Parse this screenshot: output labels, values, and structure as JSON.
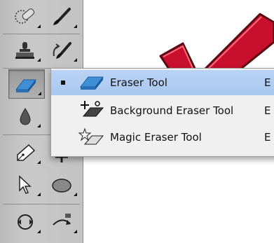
{
  "flyout_menu": {
    "items": [
      {
        "label": "Eraser Tool",
        "shortcut": "E",
        "selected": true,
        "icon": "eraser-icon"
      },
      {
        "label": "Background Eraser Tool",
        "shortcut": "E",
        "selected": false,
        "icon": "background-eraser-icon"
      },
      {
        "label": "Magic Eraser Tool",
        "shortcut": "E",
        "selected": false,
        "icon": "magic-eraser-icon"
      }
    ]
  },
  "toolbar": {
    "tools": [
      {
        "icon": "spot-healing-brush-icon"
      },
      {
        "icon": "brush-icon"
      },
      {
        "icon": "clone-stamp-icon"
      },
      {
        "icon": "history-brush-icon"
      },
      {
        "icon": "eraser-icon",
        "active": true
      },
      {
        "icon": "blur-drop-icon"
      },
      {
        "icon": "text-tool-icon"
      },
      {
        "icon": "pen-icon"
      },
      {
        "icon": "path-selection-arrow-icon"
      },
      {
        "icon": "ellipse-shape-icon"
      },
      {
        "icon": "rotate-view-icon"
      },
      {
        "icon": "3d-rotate-icon"
      }
    ]
  },
  "colors": {
    "selection_highlight": "#b9d3f5",
    "checkmark_red": "#c8102e",
    "eraser_blue": "#3f8fd6"
  }
}
